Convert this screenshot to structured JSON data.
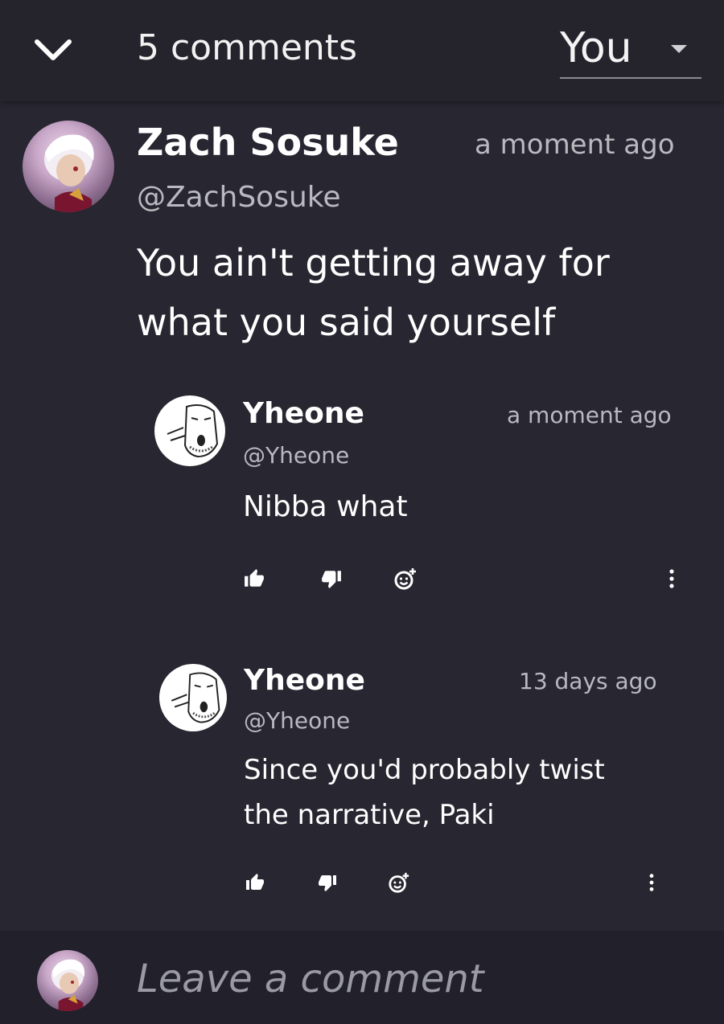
{
  "header": {
    "comment_count": "5 comments",
    "sort_value": "You"
  },
  "comments": [
    {
      "author": "Zach Sosuke",
      "handle": "@ZachSosuke",
      "timestamp": "a moment ago",
      "lines": [
        "You ain't getting away for",
        "what you said yourself"
      ],
      "avatar_icon": "anime-avatar"
    }
  ],
  "replies": [
    {
      "author": "Yheone",
      "handle": "@Yheone",
      "timestamp": "a moment ago",
      "lines": [
        "Nibba what"
      ],
      "avatar_icon": "wojak-avatar"
    },
    {
      "author": "Yheone",
      "handle": "@Yheone",
      "timestamp": "13 days ago",
      "lines": [
        "Since you'd probably twist",
        "the narrative, Paki"
      ],
      "avatar_icon": "wojak-avatar"
    }
  ],
  "footer": {
    "placeholder": "Leave a comment"
  },
  "colors": {
    "background": "#282630",
    "header": "#25232c",
    "footer": "#22202a",
    "muted_text": "#b9b9c0"
  }
}
